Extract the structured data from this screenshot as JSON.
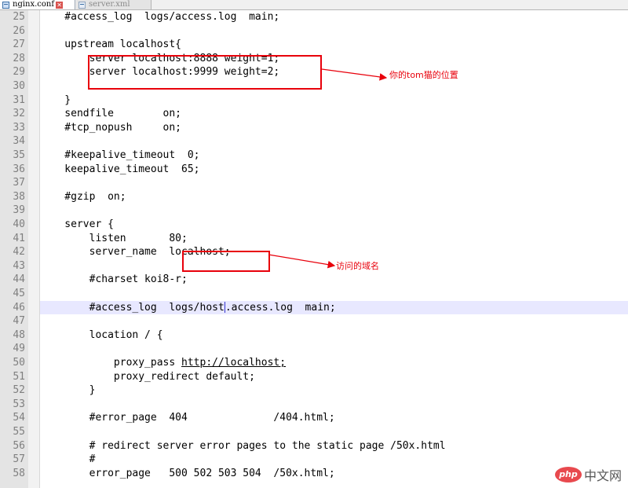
{
  "tabs": [
    {
      "label": "nginx.conf",
      "close": "✕"
    },
    {
      "label": "server.xml",
      "close": "✕"
    }
  ],
  "lines": [
    {
      "n": "25",
      "text": "    #access_log  logs/access.log  main;"
    },
    {
      "n": "26",
      "text": ""
    },
    {
      "n": "27",
      "text": "    upstream localhost{"
    },
    {
      "n": "28",
      "text": "        server localhost:8888 weight=1;"
    },
    {
      "n": "29",
      "text": "        server localhost:9999 weight=2;"
    },
    {
      "n": "30",
      "text": ""
    },
    {
      "n": "31",
      "text": "    }"
    },
    {
      "n": "32",
      "text": "    sendfile        on;"
    },
    {
      "n": "33",
      "text": "    #tcp_nopush     on;"
    },
    {
      "n": "34",
      "text": ""
    },
    {
      "n": "35",
      "text": "    #keepalive_timeout  0;"
    },
    {
      "n": "36",
      "text": "    keepalive_timeout  65;"
    },
    {
      "n": "37",
      "text": ""
    },
    {
      "n": "38",
      "text": "    #gzip  on;"
    },
    {
      "n": "39",
      "text": ""
    },
    {
      "n": "40",
      "text": "    server {"
    },
    {
      "n": "41",
      "text": "        listen       80;"
    },
    {
      "n": "42",
      "text": "        server_name  localhost;"
    },
    {
      "n": "43",
      "text": ""
    },
    {
      "n": "44",
      "text": "        #charset koi8-r;"
    },
    {
      "n": "45",
      "text": ""
    },
    {
      "n": "46",
      "before": "        #access_log  logs/host",
      "after": ".access.log  main;"
    },
    {
      "n": "47",
      "text": ""
    },
    {
      "n": "48",
      "text": "        location / {"
    },
    {
      "n": "49",
      "text": ""
    },
    {
      "n": "50",
      "before": "            proxy_pass ",
      "link": "http://localhost;"
    },
    {
      "n": "51",
      "text": "            proxy_redirect default;"
    },
    {
      "n": "52",
      "text": "        }"
    },
    {
      "n": "53",
      "text": ""
    },
    {
      "n": "54",
      "text": "        #error_page  404              /404.html;"
    },
    {
      "n": "55",
      "text": ""
    },
    {
      "n": "56",
      "text": "        # redirect server error pages to the static page /50x.html"
    },
    {
      "n": "57",
      "text": "        #"
    },
    {
      "n": "58",
      "text": "        error_page   500 502 503 504  /50x.html;"
    }
  ],
  "annotations": {
    "upstream_note": "你的tom猫的位置",
    "server_name_note": "访问的域名"
  },
  "watermark": {
    "logo": "php",
    "text": "中文网"
  },
  "colors": {
    "annotation": "#e8000b",
    "current_line": "#e8e8ff",
    "gutter": "#e4e4e4"
  }
}
